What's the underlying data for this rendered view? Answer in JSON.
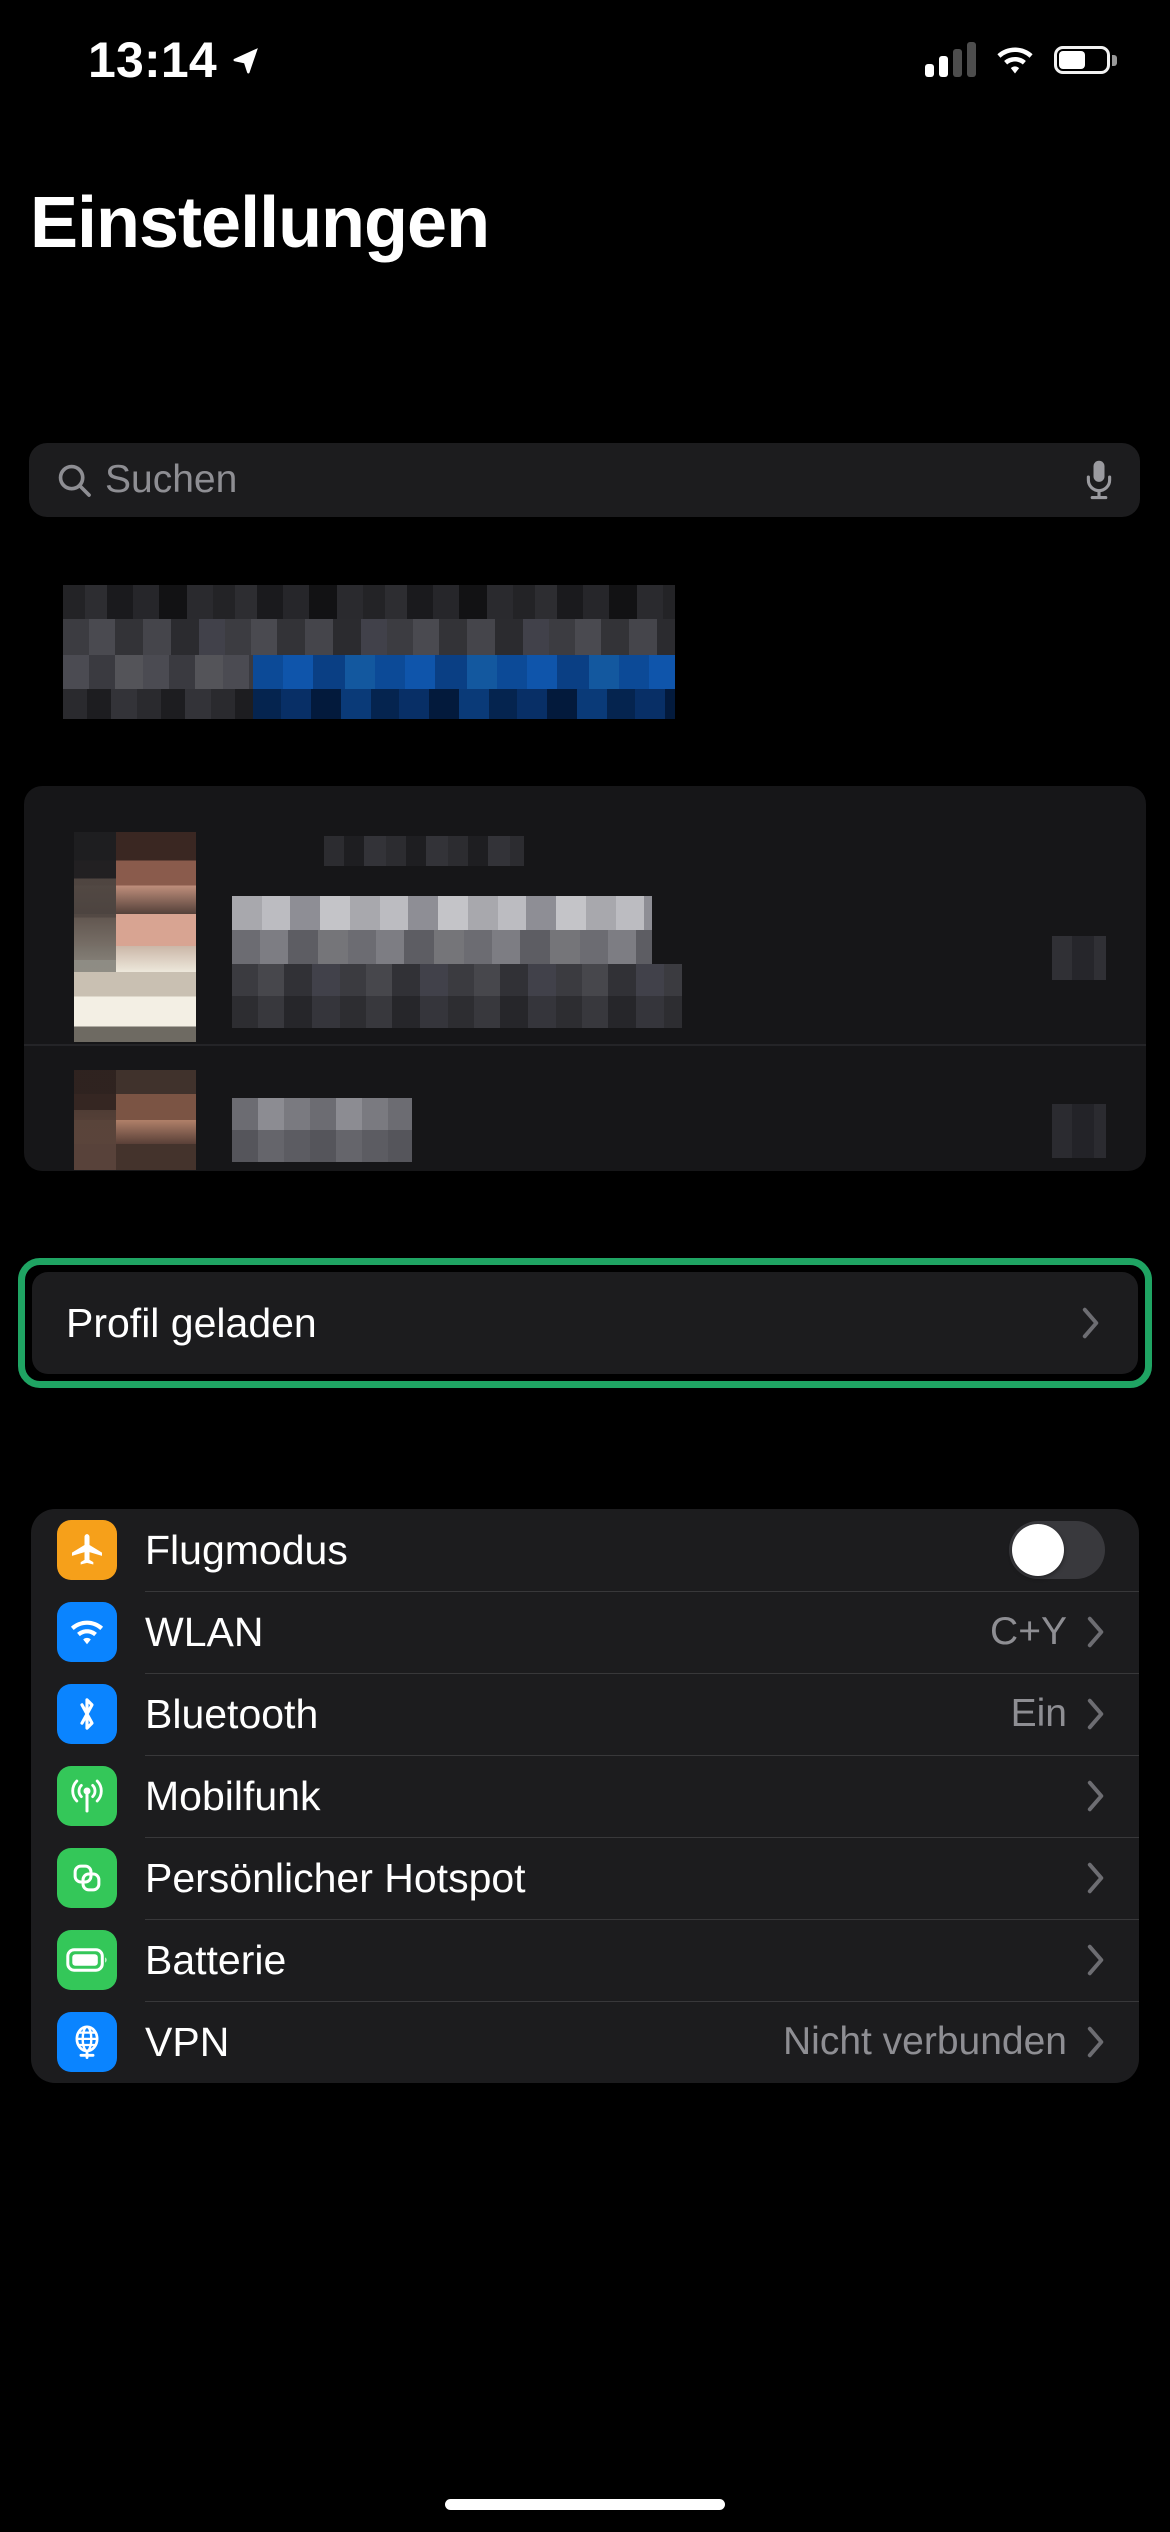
{
  "status_bar": {
    "time": "13:14",
    "location_icon": "location-arrow-icon",
    "cellular_icon": "cellular-signal-icon",
    "cellular_bars_filled": 2,
    "cellular_bars_total": 4,
    "wifi_icon": "wifi-icon",
    "battery_icon": "battery-icon",
    "battery_level_percent": 55
  },
  "header": {
    "title": "Einstellungen"
  },
  "search": {
    "placeholder": "Suchen",
    "value": "",
    "search_icon": "search-icon",
    "dictation_icon": "microphone-icon"
  },
  "redacted": {
    "banner_label": "",
    "apple_id_label": "",
    "apple_id_subtitle": "",
    "family_member_label": ""
  },
  "profile_cell": {
    "label": "Profil geladen",
    "highlighted": true,
    "highlight_color": "#1fa463",
    "chevron_icon": "chevron-right-icon"
  },
  "settings_group": {
    "rows": [
      {
        "label": "Flugmodus",
        "icon": "airplane-icon",
        "icon_color": "#f6a01a",
        "control": "toggle",
        "toggle_on": false,
        "value": ""
      },
      {
        "label": "WLAN",
        "icon": "wifi-icon",
        "icon_color": "#0a84ff",
        "control": "chevron",
        "value": "C+Y"
      },
      {
        "label": "Bluetooth",
        "icon": "bluetooth-icon",
        "icon_color": "#0a84ff",
        "control": "chevron",
        "value": "Ein"
      },
      {
        "label": "Mobilfunk",
        "icon": "cellular-antenna-icon",
        "icon_color": "#34c759",
        "control": "chevron",
        "value": ""
      },
      {
        "label": "Persönlicher Hotspot",
        "icon": "hotspot-link-icon",
        "icon_color": "#34c759",
        "control": "chevron",
        "value": ""
      },
      {
        "label": "Batterie",
        "icon": "battery-icon",
        "icon_color": "#34c759",
        "control": "chevron",
        "value": ""
      },
      {
        "label": "VPN",
        "icon": "vpn-globe-icon",
        "icon_color": "#0a84ff",
        "control": "chevron",
        "value": "Nicht verbunden"
      }
    ]
  },
  "home_indicator": {
    "label": "home-indicator"
  },
  "colors": {
    "background": "#000000",
    "cell": "#1c1c1e",
    "separator": "#38383a",
    "secondary_text": "#8e8e93",
    "accent_green": "#1fa463",
    "accent_blue": "#0a84ff",
    "accent_orange": "#f6a01a",
    "accent_green_icon": "#34c759",
    "redacted_link_blue": "#0b4a9c"
  }
}
